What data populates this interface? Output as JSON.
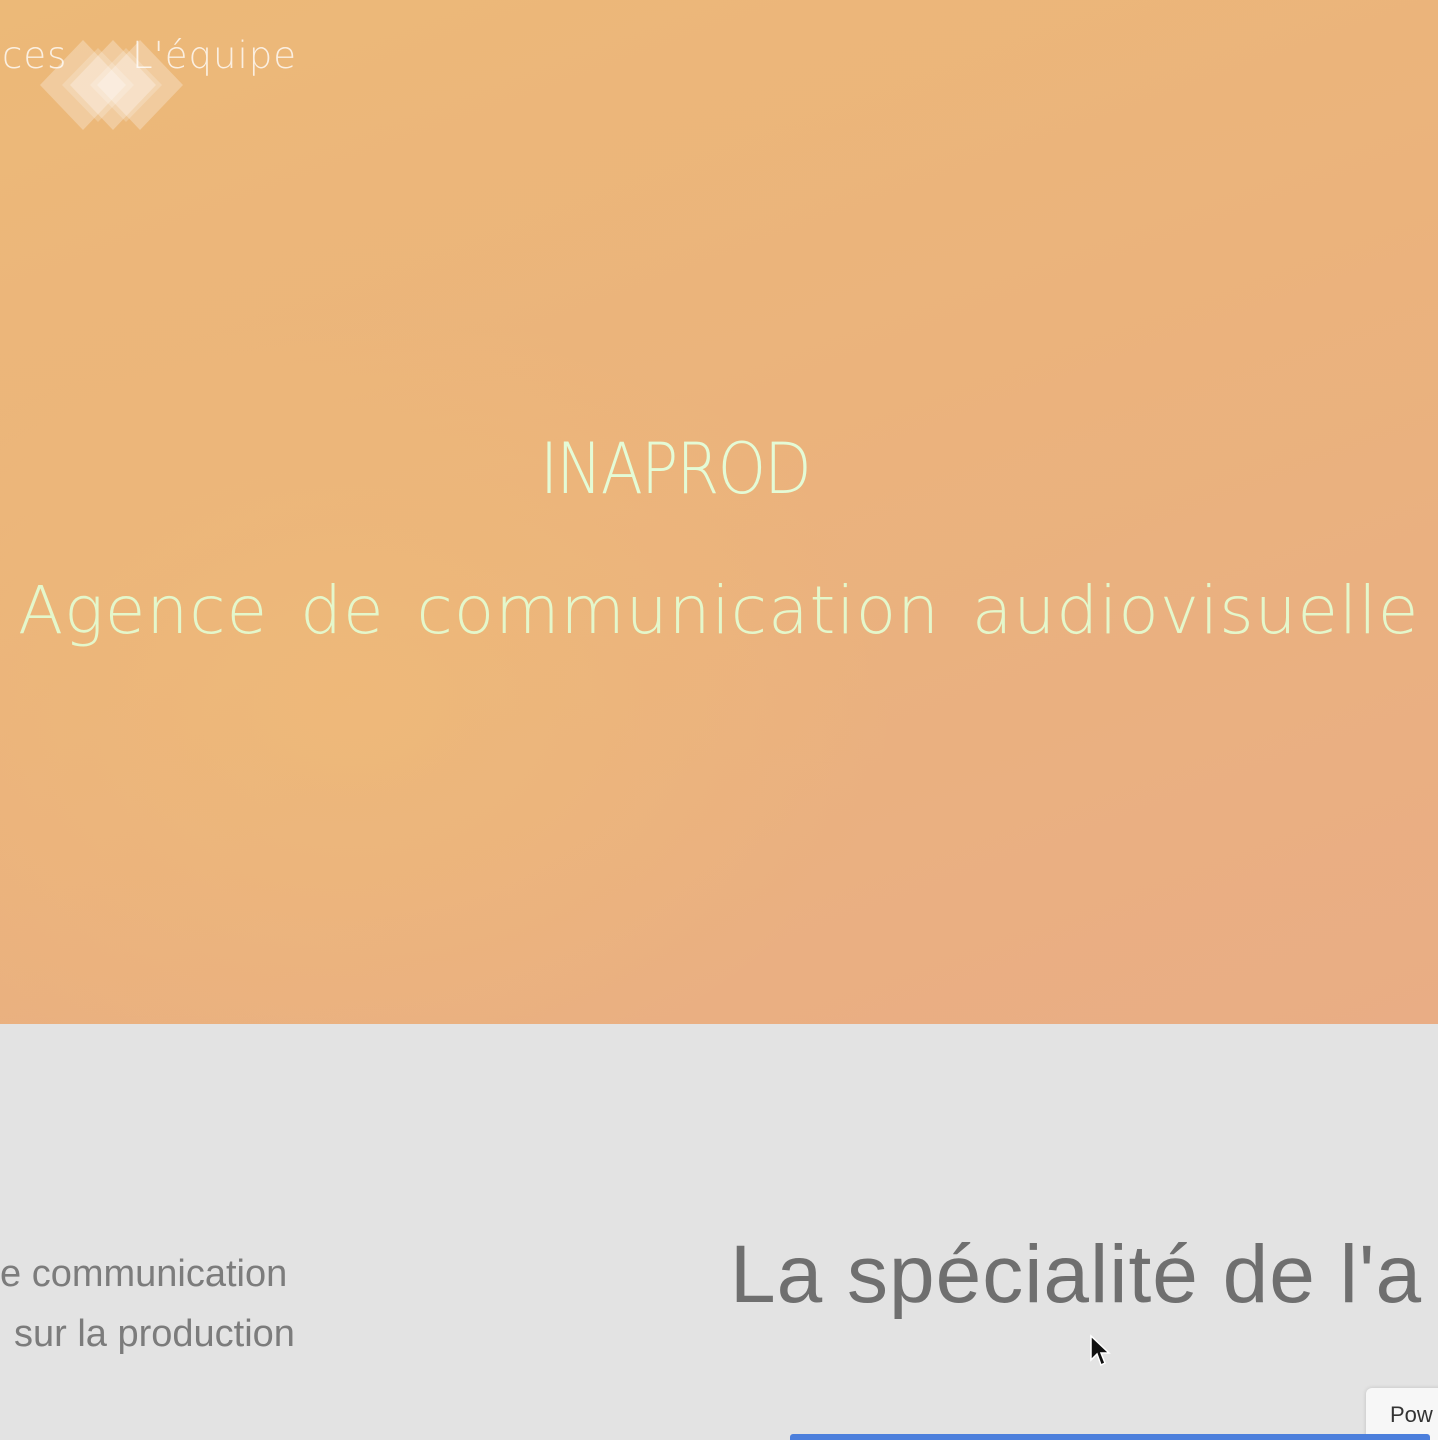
{
  "nav": {
    "items": [
      {
        "label": "ces"
      },
      {
        "label": "L'équipe"
      }
    ]
  },
  "hero": {
    "title": "INAPROD",
    "subtitle": "Agence de communication audiovisuelle"
  },
  "intro": {
    "lines": [
      "e communication",
      "sur la production"
    ]
  },
  "speciality": {
    "heading": "La spécialité de l'a"
  },
  "badge": {
    "label": "Pow"
  },
  "colors": {
    "hero_gradient_start": "#ecb978",
    "hero_gradient_end": "#e9ad85",
    "hero_text": "#e4fbd6",
    "section_bg": "#e3e3e3",
    "body_text": "#7c7c7c",
    "accent_bar": "#4c7fdc"
  }
}
